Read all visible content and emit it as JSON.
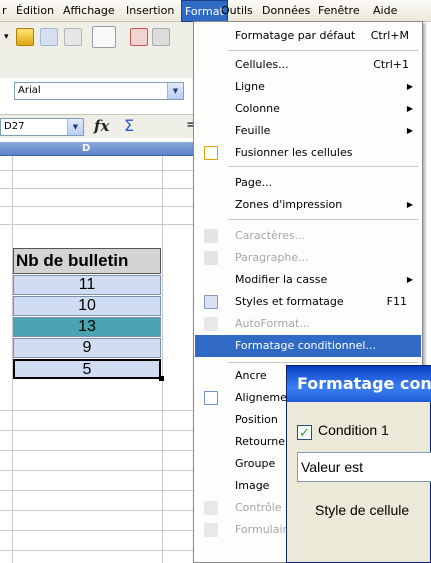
{
  "menubar": {
    "items": [
      "r",
      "Édition",
      "Affichage",
      "Insertion",
      "Format",
      "Outils",
      "Données",
      "Fenêtre",
      "Aide"
    ],
    "active_index": 4
  },
  "toolbar": {
    "font_name": "Arial",
    "cell_ref": "D27"
  },
  "formula_bar": {
    "fx": "fx",
    "sigma": "Σ",
    "equals": "="
  },
  "sheet": {
    "column_header": "D",
    "header_cell": "Nb de bulletin",
    "values": [
      "11",
      "10",
      "13",
      "9",
      "5"
    ]
  },
  "format_menu": {
    "items": [
      {
        "label": "Formatage par défaut",
        "shortcut": "Ctrl+M",
        "disabled": false,
        "submenu": false
      },
      {
        "label": "Cellules...",
        "shortcut": "Ctrl+1",
        "disabled": false,
        "submenu": false
      },
      {
        "label": "Ligne",
        "shortcut": "",
        "disabled": false,
        "submenu": true
      },
      {
        "label": "Colonne",
        "shortcut": "",
        "disabled": false,
        "submenu": true
      },
      {
        "label": "Feuille",
        "shortcut": "",
        "disabled": false,
        "submenu": true
      },
      {
        "label": "Fusionner les cellules",
        "shortcut": "",
        "disabled": false,
        "submenu": false
      },
      {
        "label": "Page...",
        "shortcut": "",
        "disabled": false,
        "submenu": false
      },
      {
        "label": "Zones d'impression",
        "shortcut": "",
        "disabled": false,
        "submenu": true
      },
      {
        "label": "Caractères...",
        "shortcut": "",
        "disabled": true,
        "submenu": false
      },
      {
        "label": "Paragraphe...",
        "shortcut": "",
        "disabled": true,
        "submenu": false
      },
      {
        "label": "Modifier la casse",
        "shortcut": "",
        "disabled": false,
        "submenu": true
      },
      {
        "label": "Styles et formatage",
        "shortcut": "F11",
        "disabled": false,
        "submenu": false
      },
      {
        "label": "AutoFormat...",
        "shortcut": "",
        "disabled": true,
        "submenu": false
      },
      {
        "label": "Formatage conditionnel...",
        "shortcut": "",
        "disabled": false,
        "submenu": false,
        "selected": true
      },
      {
        "label": "Ancre",
        "shortcut": "",
        "disabled": false,
        "submenu": true
      },
      {
        "label": "Alignement",
        "shortcut": "",
        "disabled": false,
        "submenu": false
      },
      {
        "label": "Position",
        "shortcut": "",
        "disabled": false,
        "submenu": false
      },
      {
        "label": "Retourner",
        "shortcut": "",
        "disabled": false,
        "submenu": false
      },
      {
        "label": "Groupe",
        "shortcut": "",
        "disabled": false,
        "submenu": false
      },
      {
        "label": "Image",
        "shortcut": "",
        "disabled": false,
        "submenu": false
      },
      {
        "label": "Contrôle",
        "shortcut": "",
        "disabled": true,
        "submenu": false
      },
      {
        "label": "Formulaire",
        "shortcut": "",
        "disabled": true,
        "submenu": false
      }
    ]
  },
  "dialog": {
    "title": "Formatage conditionnel",
    "condition_label": "Condition 1",
    "condition_checked": true,
    "select_value": "Valeur est",
    "style_label": "Style de cellule"
  },
  "colors": {
    "menu_highlight": "#316ac5",
    "cell_blue": "#cfdcf2",
    "cell_teal": "#4aa3b0",
    "header_gray": "#d4d4d4"
  }
}
